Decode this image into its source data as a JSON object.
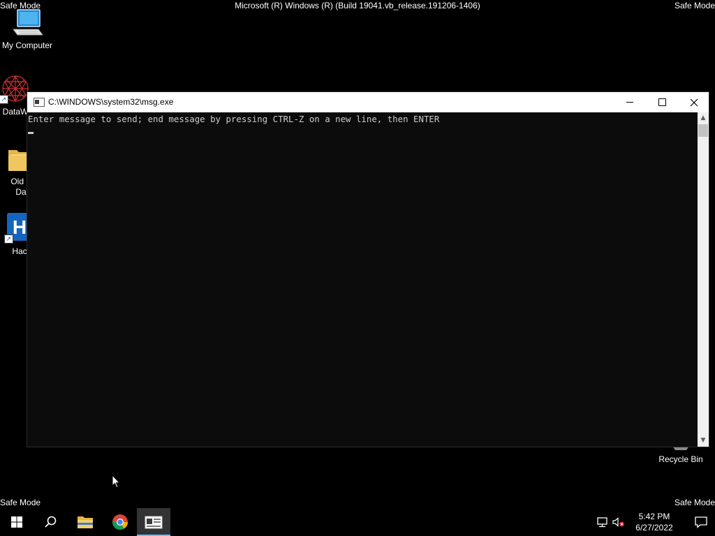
{
  "desktop": {
    "safe_mode_label": "Safe Mode",
    "build_label": "Microsoft (R) Windows (R) (Build 19041.vb_release.191206-1406)",
    "icons": [
      {
        "label": "My Computer",
        "icon": "my-computer-icon"
      },
      {
        "label": "DataW",
        "icon": "datawatch-app-icon"
      },
      {
        "label_line1": "Old F",
        "label_line2": "Da",
        "icon": "folder-icon"
      },
      {
        "label": "Hac",
        "icon": "hack-app-icon"
      },
      {
        "label": "Recycle Bin",
        "icon": "recycle-bin-icon"
      }
    ]
  },
  "window": {
    "title": "C:\\WINDOWS\\system32\\msg.exe",
    "icon": "console-app-icon",
    "prompt": "Enter message to send; end message by pressing CTRL-Z on a new line, then ENTER",
    "controls": {
      "minimize": "minimize-icon",
      "maximize": "maximize-icon",
      "close": "close-icon"
    }
  },
  "taskbar": {
    "buttons": [
      {
        "name": "start",
        "icon": "windows-logo-icon"
      },
      {
        "name": "search",
        "icon": "search-icon"
      },
      {
        "name": "file-explorer",
        "icon": "folder-icon"
      },
      {
        "name": "chrome",
        "icon": "chrome-icon"
      },
      {
        "name": "msg-exe",
        "icon": "console-app-icon",
        "active": true
      }
    ],
    "tray": {
      "network_icon": "network-icon",
      "volume_icon": "volume-muted-icon",
      "notification_icon": "action-center-icon"
    },
    "clock": {
      "time": "5:42 PM",
      "date": "6/27/2022"
    }
  },
  "colors": {
    "desktop_bg": "#000000",
    "console_bg": "#0c0c0c",
    "console_text": "#cccccc",
    "titlebar_bg": "#ffffff",
    "taskbar_active": "#333333",
    "accent": "#76b9ed"
  }
}
